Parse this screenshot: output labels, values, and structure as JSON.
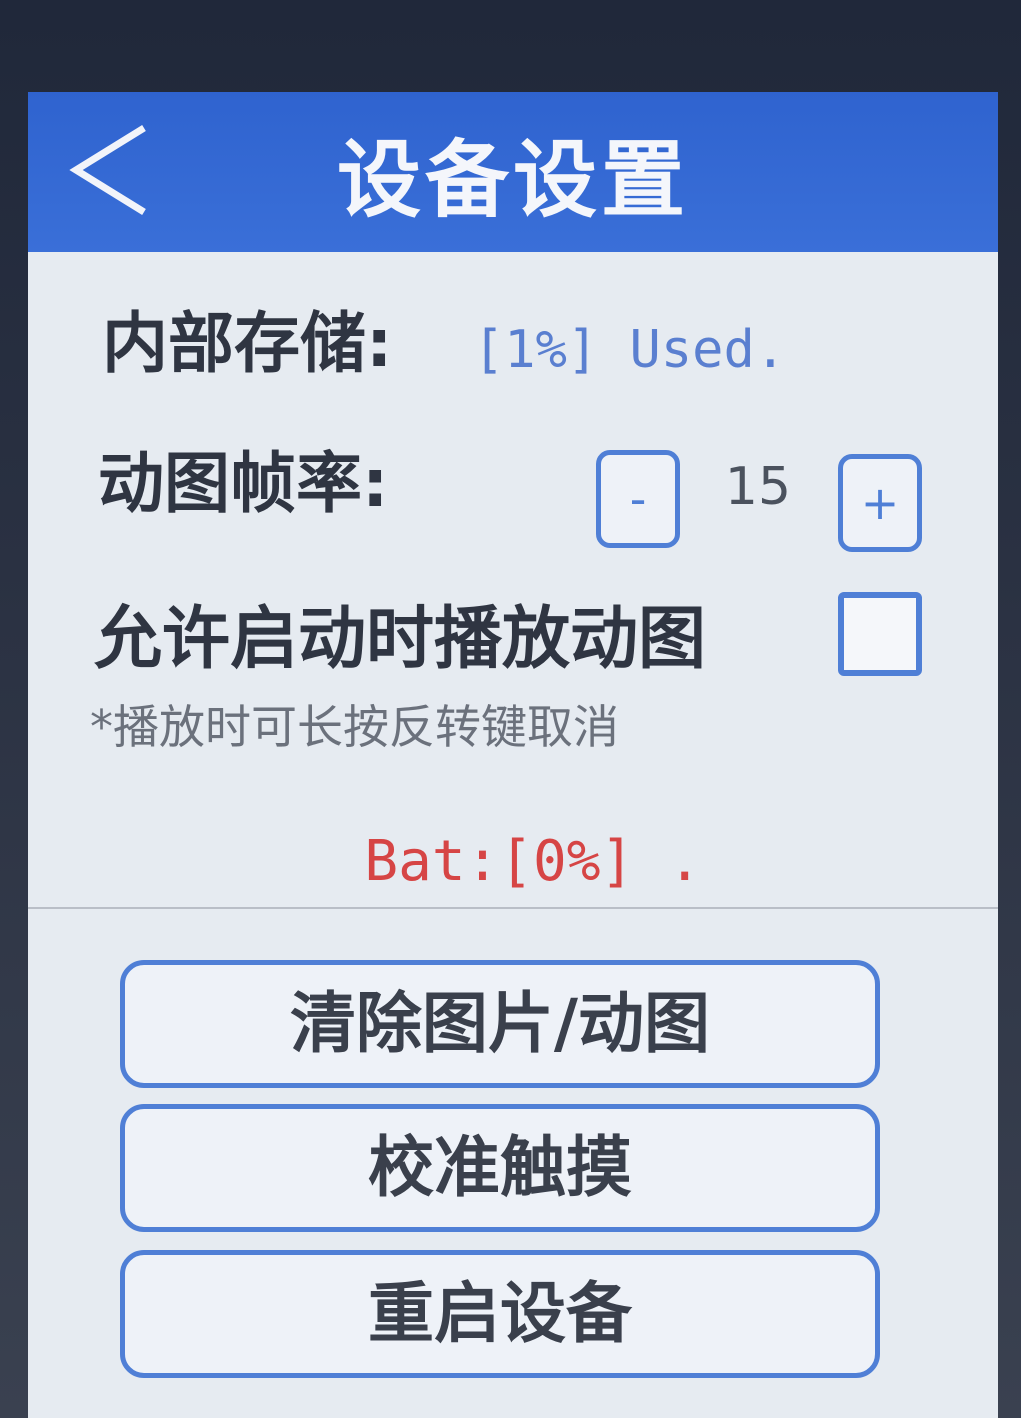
{
  "header": {
    "title": "设备设置",
    "back_icon": "chevron-left-icon"
  },
  "storage": {
    "label": "内部存储:",
    "value": "[1%] Used."
  },
  "frame_rate": {
    "label": "动图帧率:",
    "decrement_label": "-",
    "value": "15",
    "increment_label": "+"
  },
  "autoplay": {
    "label": "允许启动时播放动图",
    "checked": false,
    "hint": "*播放时可长按反转键取消"
  },
  "battery": {
    "text": "Bat:[0%] ."
  },
  "actions": {
    "clear_label": "清除图片/动图",
    "calibrate_label": "校准触摸",
    "restart_label": "重启设备"
  },
  "colors": {
    "header": "#3a6fd8",
    "accent": "#4f7fd6",
    "battery": "#d64545",
    "background": "#e6ebf1"
  }
}
